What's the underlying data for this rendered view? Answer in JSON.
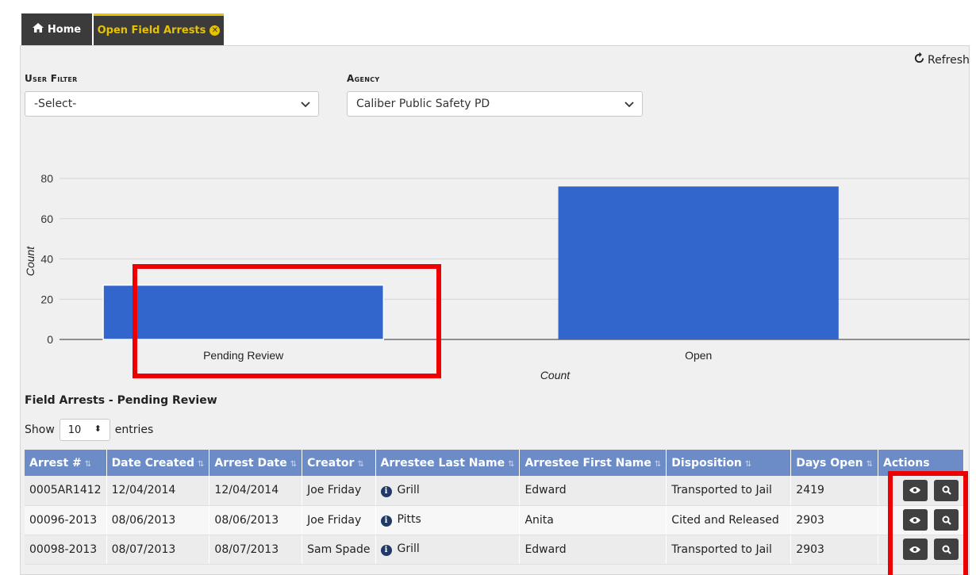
{
  "tabs": {
    "home_label": "Home",
    "open_label": "Open Field Arrests"
  },
  "refresh_label": "Refresh",
  "filters": {
    "user_filter_label": "User Filter",
    "user_filter_value": "-Select-",
    "agency_label": "Agency",
    "agency_value": "Caliber Public Safety PD"
  },
  "colors": {
    "bar": "#3366cc",
    "header": "#6b8cc7",
    "tab_active": "#e6c200",
    "highlight": "#ee0000"
  },
  "chart_data": {
    "type": "bar",
    "categories": [
      "Pending Review",
      "Open"
    ],
    "values": [
      27,
      76
    ],
    "xlabel": "Count",
    "ylabel": "Count",
    "ylim": [
      0,
      80
    ],
    "yticks": [
      0,
      20,
      40,
      60,
      80
    ],
    "grid": true
  },
  "table_section": {
    "title": "Field Arrests - Pending Review",
    "show_label": "Show",
    "entries_value": "10",
    "entries_label": "entries",
    "columns": [
      "Arrest #",
      "Date Created",
      "Arrest Date",
      "Creator",
      "Arrestee Last Name",
      "Arrestee First Name",
      "Disposition",
      "Days Open",
      "Actions"
    ],
    "rows": [
      [
        "0005AR1412",
        "12/04/2014",
        "12/04/2014",
        "Joe Friday",
        "Grill",
        "Edward",
        "Transported to Jail",
        "2419"
      ],
      [
        "00096-2013",
        "08/06/2013",
        "08/06/2013",
        "Joe Friday",
        "Pitts",
        "Anita",
        "Cited and Released",
        "2903"
      ],
      [
        "00098-2013",
        "08/07/2013",
        "08/07/2013",
        "Sam Spade",
        "Grill",
        "Edward",
        "Transported to Jail",
        "2903"
      ]
    ]
  }
}
